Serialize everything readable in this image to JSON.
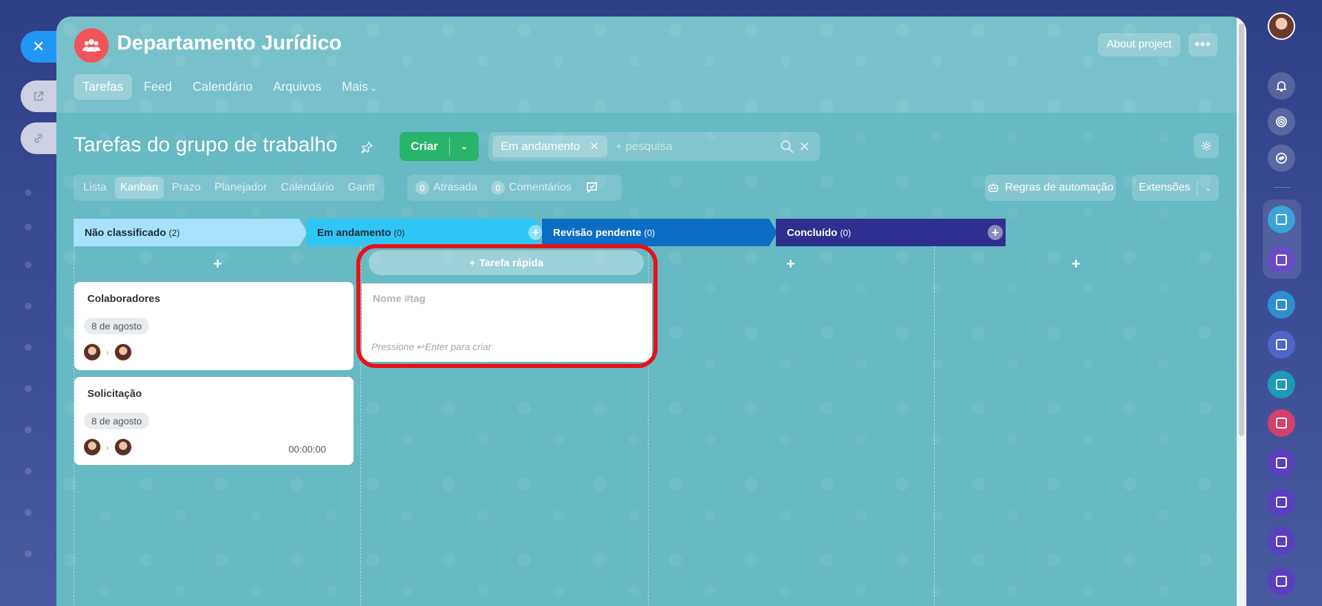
{
  "left_rail": {
    "close_icon": "close-icon",
    "open_new_icon": "external-link-icon",
    "copy_link_icon": "link-icon"
  },
  "header": {
    "group_title": "Departamento Jurídico",
    "about_label": "About project",
    "more_label": "•••",
    "nav": [
      {
        "label": "Tarefas",
        "active": true
      },
      {
        "label": "Feed"
      },
      {
        "label": "Calendário"
      },
      {
        "label": "Arquivos"
      },
      {
        "label": "Mais"
      }
    ]
  },
  "toolbar": {
    "page_title": "Tarefas do grupo de trabalho",
    "create_label": "Criar",
    "filter_chip": "Em andamento",
    "search_placeholder": "+ pesquisa"
  },
  "views": {
    "tabs": [
      "Lista",
      "Kanban",
      "Prazo",
      "Planejador",
      "Calendário",
      "Gantt"
    ],
    "active": "Kanban",
    "counters": [
      {
        "count": "0",
        "label": "Atrasada"
      },
      {
        "count": "0",
        "label": "Comentários"
      }
    ],
    "automation_label": "Regras de automação",
    "extensions_label": "Extensões"
  },
  "kanban": {
    "columns": [
      {
        "title": "Não classificado",
        "count": "(2)",
        "color": "#a6e2fb",
        "text_color": "#1d2a3a"
      },
      {
        "title": "Em andamento",
        "count": "(0)",
        "color": "#2fc6f6",
        "text_color": "#1d2a3a"
      },
      {
        "title": "Revisão pendente",
        "count": "(0)",
        "color": "#0b6ec4",
        "text_color": "#ffffff"
      },
      {
        "title": "Concluído",
        "count": "(0)",
        "color": "#2e2f8f",
        "text_color": "#ffffff"
      }
    ],
    "cards": [
      {
        "title": "Colaboradores",
        "date": "8 de agosto",
        "timer": ""
      },
      {
        "title": "Solicitação",
        "date": "8 de agosto",
        "timer": "00:00:00"
      }
    ],
    "quick_task": {
      "button_label": "Tarefa rápida",
      "placeholder": "Nome #tag",
      "hint_prefix": "Pressione",
      "hint_suffix": "Enter para criar"
    }
  }
}
